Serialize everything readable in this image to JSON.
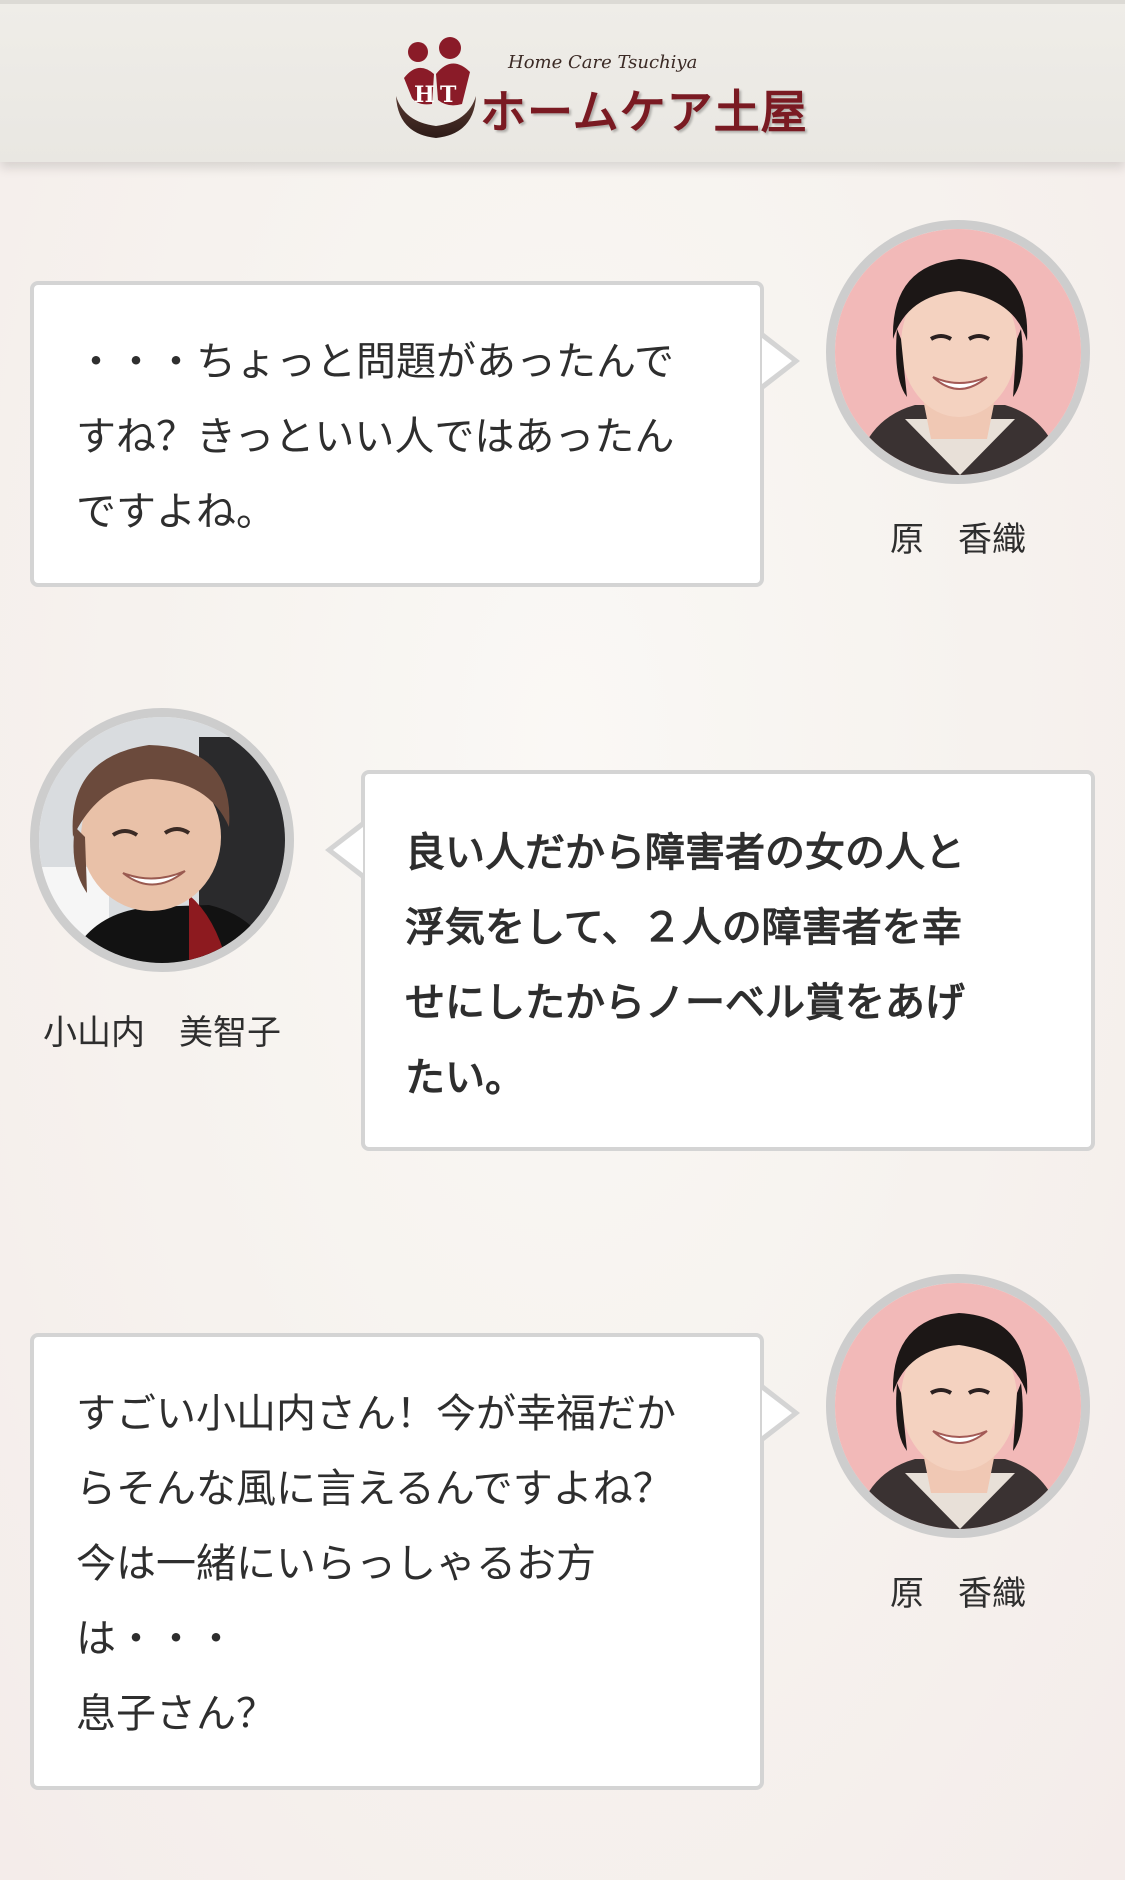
{
  "brand": {
    "name_en": "Home Care Tsuchiya",
    "name_ja": "ホームケア土屋",
    "accent_color": "#7a1a22"
  },
  "messages": [
    {
      "speaker": "原　香織",
      "side": "right",
      "text": "・・・ちょっと問題があったんで\nすね？きっといい人ではあったん\nですよね。",
      "emphasis": false
    },
    {
      "speaker": "小山内　美智子",
      "side": "left",
      "text": "良い人だから障害者の女の人と\n浮気をして、２人の障害者を幸\nせにしたからノーベル賞をあげ\nたい。",
      "emphasis": true
    },
    {
      "speaker": "原　香織",
      "side": "right",
      "text": "すごい小山内さん！今が幸福だか\nらそんな風に言えるんですよね？\n今は一緒にいらっしゃるお方\nは・・・\n息子さん？",
      "emphasis": false
    }
  ]
}
